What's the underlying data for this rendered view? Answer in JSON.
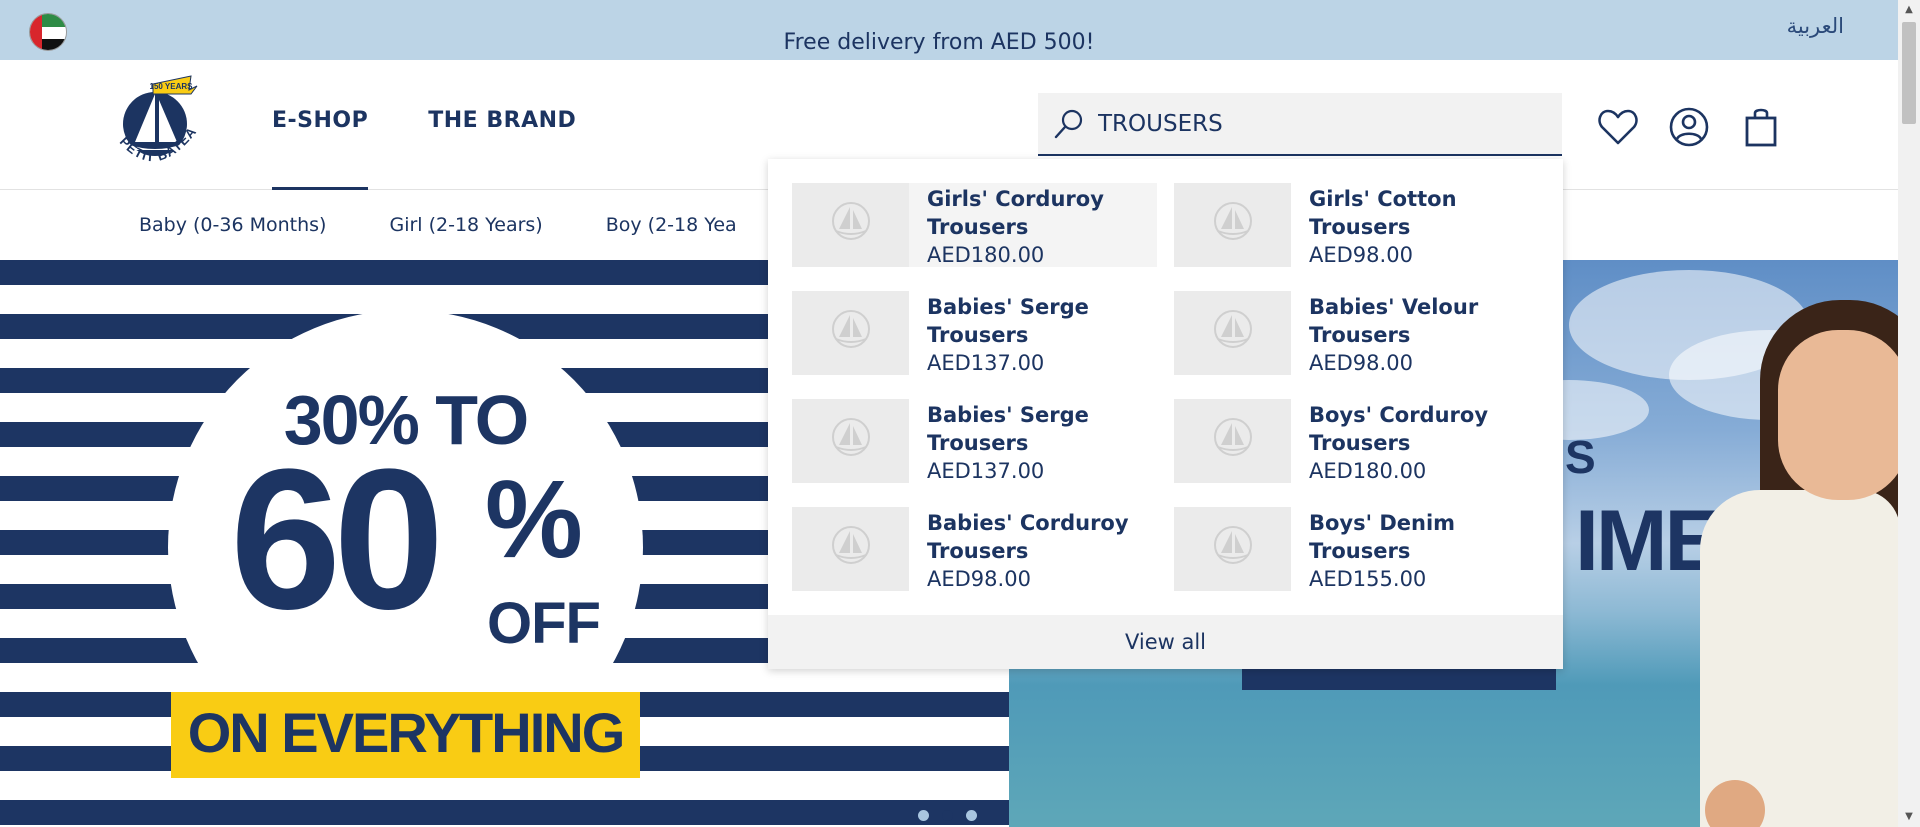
{
  "topbar": {
    "promo": "Free delivery from AED 500!",
    "language": "العربية",
    "flag_icon": "uae-flag-icon"
  },
  "header": {
    "logo_text": "PETIT BATEAU",
    "logo_badge": "150 YEARS",
    "nav": [
      {
        "label": "E-SHOP",
        "active": true
      },
      {
        "label": "THE BRAND",
        "active": false
      }
    ],
    "search": {
      "value": "TROUSERS",
      "icon": "search-icon"
    },
    "icons": [
      "heart-icon",
      "account-icon",
      "shopping-bag-icon"
    ]
  },
  "subnav": {
    "items": [
      "Baby (0-36 Months)",
      "Girl (2-18 Years)",
      "Boy (2-18 Yea"
    ]
  },
  "hero": {
    "line1": "30% TO",
    "big": "60",
    "pct": "%",
    "off": "OFF",
    "everything": "ON EVERYTHING",
    "right_word": "S",
    "right_big": "IME!",
    "active_slide": 2,
    "slides": 3
  },
  "dropdown": {
    "results": [
      {
        "name": "Girls' Corduroy Trousers",
        "price": "AED180.00",
        "highlighted": true
      },
      {
        "name": "Girls' Cotton Trousers",
        "price": "AED98.00",
        "highlighted": false
      },
      {
        "name": "Babies' Serge Trousers",
        "price": "AED137.00",
        "highlighted": false
      },
      {
        "name": "Babies' Velour Trousers",
        "price": "AED98.00",
        "highlighted": false
      },
      {
        "name": "Babies' Serge Trousers",
        "price": "AED137.00",
        "highlighted": false
      },
      {
        "name": "Boys' Corduroy Trousers",
        "price": "AED180.00",
        "highlighted": false
      },
      {
        "name": "Babies' Corduroy Trousers",
        "price": "AED98.00",
        "highlighted": false
      },
      {
        "name": "Boys' Denim Trousers",
        "price": "AED155.00",
        "highlighted": false
      }
    ],
    "view_all": "View all"
  },
  "colors": {
    "navy": "#1c3461",
    "topbar": "#bcd4e6",
    "yellow": "#f9cc14"
  }
}
